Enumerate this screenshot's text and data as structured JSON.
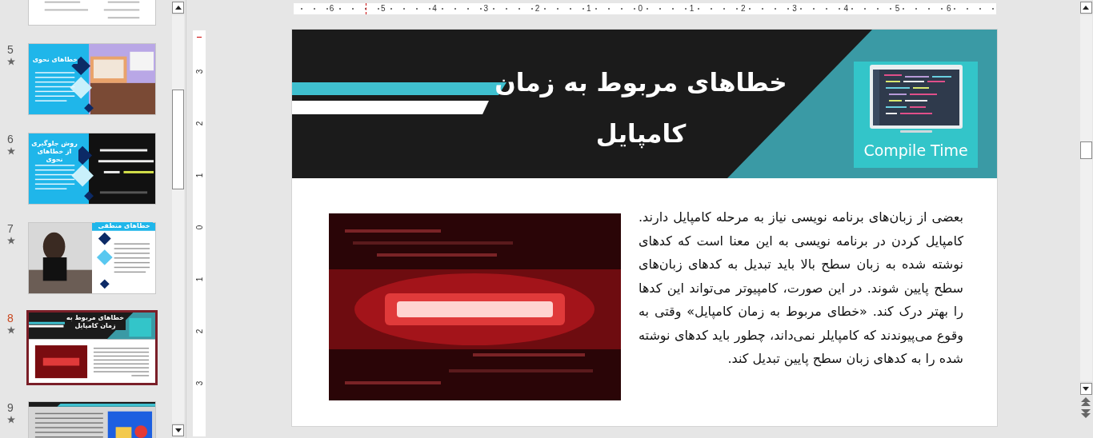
{
  "thumbnails": [
    {
      "kind": "list",
      "selected": false
    },
    {
      "number": "5",
      "kind": "syntax",
      "title": "خطاهای نحوی",
      "selected": false
    },
    {
      "number": "6",
      "kind": "code",
      "title": "روش جلوگیری از خطاهای نحوی",
      "selected": false
    },
    {
      "number": "7",
      "title": "خطاهای منطقی",
      "selected": false
    },
    {
      "number": "8",
      "kind": "header",
      "title": "خطاهای مربوط به زمان کامپایل",
      "selected": true
    },
    {
      "number": "9",
      "kind": "runtime",
      "selected": false
    }
  ],
  "horizontal_ruler": [
    "6",
    "5",
    "4",
    "3",
    "2",
    "1",
    "0",
    "1",
    "2",
    "3",
    "4",
    "5",
    "6"
  ],
  "vertical_ruler": [
    "3",
    "2",
    "1",
    "0",
    "1",
    "2",
    "3"
  ],
  "slide": {
    "title": "خطاهای مربوط به زمان کامپایل",
    "badge_label": "Compile Time",
    "body": "بعضی از زبان‌های برنامه نویسی نیاز به مرحله کامپایل دارند. کامپایل کردن در برنامه نویسی به این معنا است که کدهای نوشته شده به زبان سطح بالا باید تبدیل به کدهای زبان‌های سطح پایین شوند. در این صورت، کامپیوتر می‌تواند این کدها را بهتر درک کند. «خطای مربوط به زمان کامپایل» وقتی به وقوع می‌پیوندند که کامپایلر نمی‌داند، چطور باید کدهای نوشته شده را به کدهای زبان سطح پایین تبدیل کند."
  }
}
